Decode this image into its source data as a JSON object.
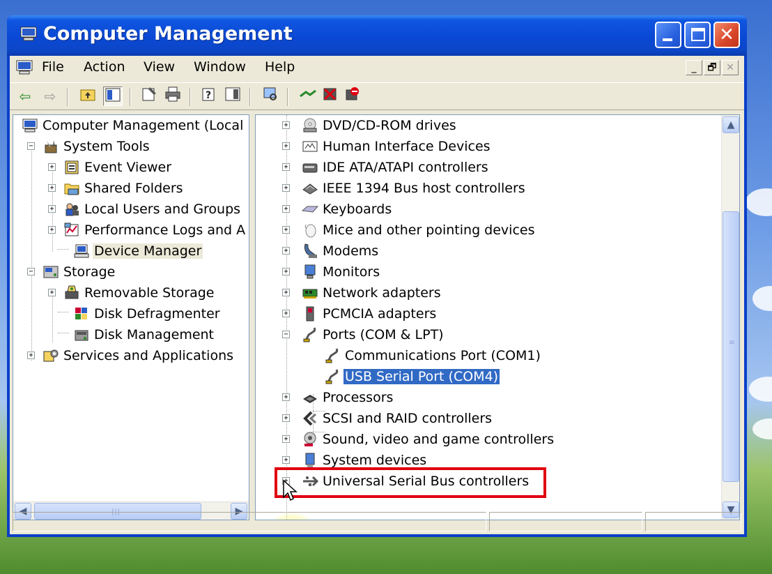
{
  "window": {
    "title": "Computer Management",
    "controls": {
      "minimize": "_",
      "maximize": "□",
      "close": "✕"
    }
  },
  "menubar": {
    "items": [
      "File",
      "Action",
      "View",
      "Window",
      "Help"
    ],
    "mdi_controls": [
      "_",
      "🗗",
      "✕"
    ]
  },
  "toolbar": {
    "buttons": [
      "back-icon",
      "forward-icon",
      "up-one-level-icon",
      "show-hide-tree-icon",
      "properties-icon",
      "print-icon",
      "help-icon",
      "show-hide-action-pane-icon",
      "scan-hardware-icon",
      "update-driver-icon",
      "uninstall-icon",
      "disable-icon"
    ]
  },
  "tree": {
    "root": "Computer Management (Local",
    "system_tools": "System Tools",
    "event_viewer": "Event Viewer",
    "shared_folders": "Shared Folders",
    "local_users": "Local Users and Groups",
    "perf_logs": "Performance Logs and A",
    "device_manager": "Device Manager",
    "storage": "Storage",
    "removable_storage": "Removable Storage",
    "disk_defrag": "Disk Defragmenter",
    "disk_management": "Disk Management",
    "services": "Services and Applications"
  },
  "devices": {
    "dvd": "DVD/CD-ROM drives",
    "hid": "Human Interface Devices",
    "ide": "IDE ATA/ATAPI controllers",
    "ieee": "IEEE 1394 Bus host controllers",
    "keyboards": "Keyboards",
    "mice": "Mice and other pointing devices",
    "modems": "Modems",
    "monitors": "Monitors",
    "network": "Network adapters",
    "pcmcia": "PCMCIA adapters",
    "ports": "Ports (COM & LPT)",
    "com1": "Communications Port (COM1)",
    "com4": "USB Serial Port (COM4)",
    "processors": "Processors",
    "scsi": "SCSI and RAID controllers",
    "sound": "Sound, video and game controllers",
    "system": "System devices",
    "usb": "Universal Serial Bus controllers"
  },
  "scroll": {
    "up": "▲",
    "down": "▼",
    "left": "◀",
    "right": "▶",
    "grip_h": "|||",
    "grip_v": "≡"
  },
  "expander": {
    "plus": "+",
    "minus": "−"
  },
  "colors": {
    "highlight": "#e00010",
    "selection": "#316ac5",
    "titlebar": "#0a48d4"
  }
}
